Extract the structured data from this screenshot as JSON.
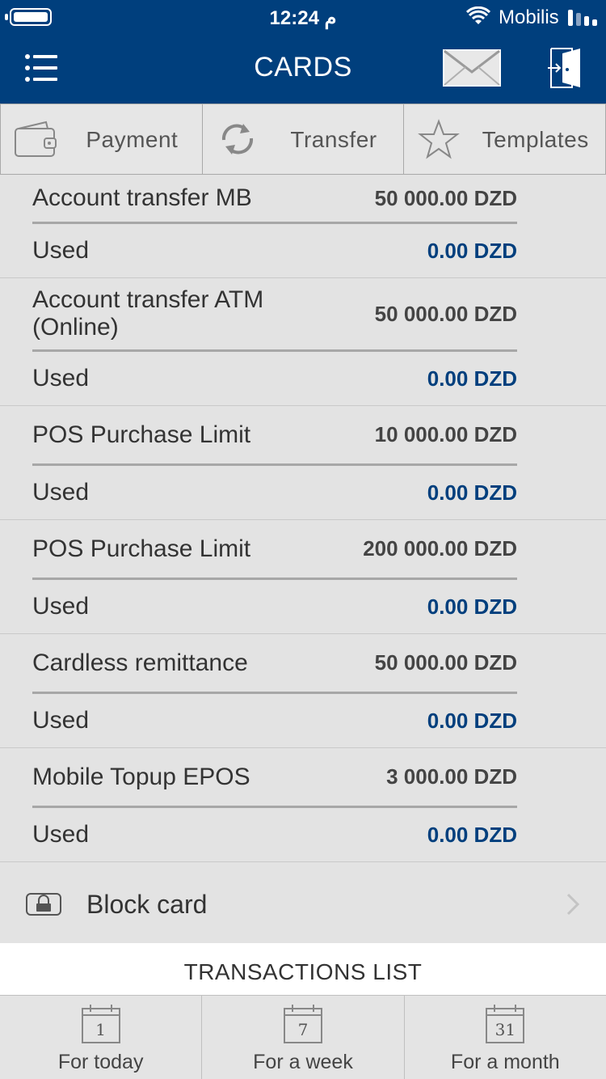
{
  "status_bar": {
    "time": "12:24 م",
    "carrier": "Mobilis"
  },
  "header": {
    "title": "CARDS"
  },
  "top_tabs": [
    {
      "label": "Payment",
      "icon": "wallet-icon"
    },
    {
      "label": "Transfer",
      "icon": "refresh-icon"
    },
    {
      "label": "Templates",
      "icon": "star-icon"
    }
  ],
  "limits": [
    {
      "name": "Account transfer MB",
      "amount": "50 000.00 DZD",
      "used_label": "Used",
      "used": "0.00 DZD"
    },
    {
      "name": "Account transfer ATM (Online)",
      "amount": "50 000.00 DZD",
      "used_label": "Used",
      "used": "0.00 DZD"
    },
    {
      "name": "POS Purchase Limit",
      "amount": "10 000.00 DZD",
      "used_label": "Used",
      "used": "0.00 DZD"
    },
    {
      "name": "POS Purchase Limit",
      "amount": "200 000.00 DZD",
      "used_label": "Used",
      "used": "0.00 DZD"
    },
    {
      "name": "Cardless remittance",
      "amount": "50 000.00 DZD",
      "used_label": "Used",
      "used": "0.00 DZD"
    },
    {
      "name": "Mobile Topup EPOS",
      "amount": "3 000.00 DZD",
      "used_label": "Used",
      "used": "0.00 DZD"
    }
  ],
  "block_card": {
    "label": "Block card",
    "icon": "lock-icon"
  },
  "transactions": {
    "title": "TRANSACTIONS LIST"
  },
  "bottom_tabs": [
    {
      "label": "For today",
      "day": "1"
    },
    {
      "label": "For a week",
      "day": "7"
    },
    {
      "label": "For a month",
      "day": "31"
    }
  ],
  "colors": {
    "brand": "#003f7d",
    "used_amount": "#003f7d"
  }
}
